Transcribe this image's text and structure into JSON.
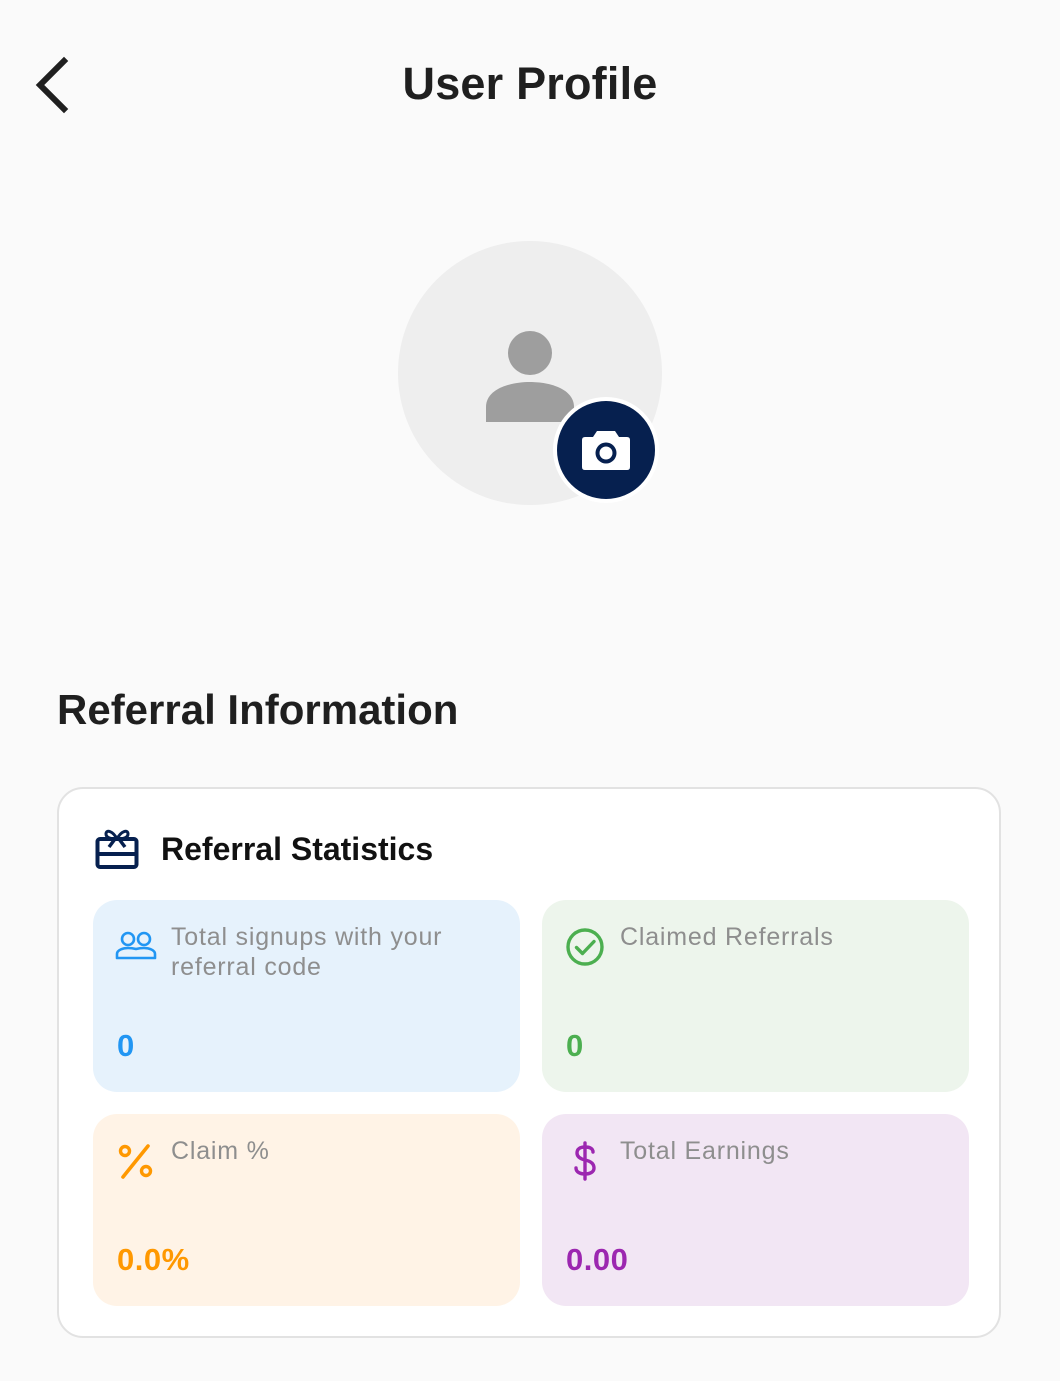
{
  "header": {
    "title": "User Profile",
    "back_icon": "chevron-left-icon"
  },
  "profile": {
    "avatar_icon": "person-icon",
    "camera_icon": "camera-icon"
  },
  "referral": {
    "section_title": "Referral Information",
    "card_title": "Referral Statistics",
    "card_icon": "gift-card-icon",
    "stats": [
      {
        "label": "Total signups with your referral code",
        "value": "0",
        "icon": "group-icon",
        "color": "#2196f3",
        "background": "#e6f2fc"
      },
      {
        "label": "Claimed Referrals",
        "value": "0",
        "icon": "check-circle-icon",
        "color": "#4caf50",
        "background": "#edf5ec"
      },
      {
        "label": "Claim %",
        "value": "0.0%",
        "icon": "percent-icon",
        "color": "#ff9800",
        "background": "#fff3e6"
      },
      {
        "label": "Total Earnings",
        "value": "0.00",
        "icon": "dollar-icon",
        "color": "#9c27b0",
        "background": "#f2e6f4"
      }
    ]
  },
  "colors": {
    "primary": "#06204f",
    "page_background": "#fafafa"
  }
}
